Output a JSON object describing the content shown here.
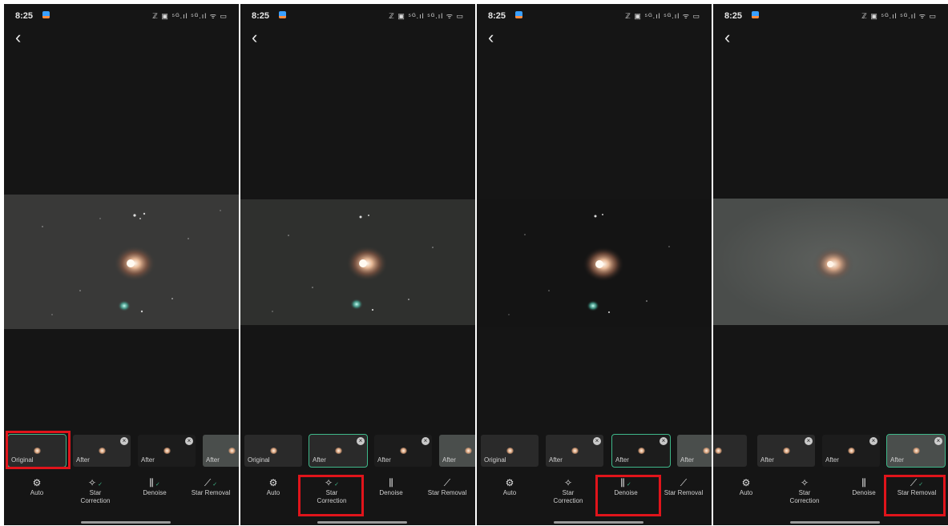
{
  "status_bar": {
    "time": "8:25",
    "icons_text": "ℤ ▣ ⁵ᴳ.ıl ⁵ᴳ.ıl ᯤ ▭"
  },
  "back_glyph": "‹",
  "thumbs": {
    "original": "Original",
    "after": "After",
    "close": "×"
  },
  "tools": {
    "auto": "Auto",
    "star_correction_l1": "Star",
    "star_correction_l2": "Correction",
    "denoise": "Denoise",
    "star_removal": "Star Removal"
  },
  "icons": {
    "auto": "gear-icon",
    "star_correction": "sparkle-stars-icon",
    "denoise": "denoise-bars-icon",
    "star_removal": "star-removal-icon",
    "back": "chevron-left-icon",
    "check": "check-icon"
  },
  "colors": {
    "selected_accent": "#3fb88a",
    "highlight_box": "#e0141b",
    "background": "#151515"
  }
}
